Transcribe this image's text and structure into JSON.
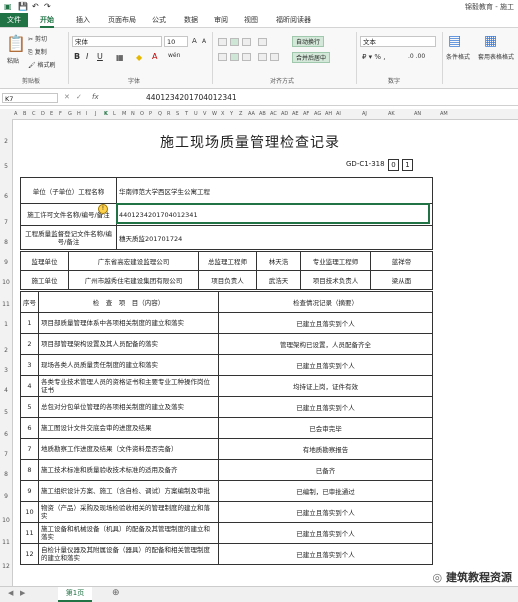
{
  "app": {
    "title": "锦毅教育 - 施工",
    "quick_access": [
      "save-icon",
      "undo-icon",
      "redo-icon"
    ]
  },
  "tabs": [
    "文件",
    "开始",
    "插入",
    "页面布局",
    "公式",
    "数据",
    "审阅",
    "视图",
    "福昕阅读器"
  ],
  "ribbon": {
    "clipboard": {
      "paste": "粘贴",
      "cut": "剪切",
      "copy": "复制",
      "format_painter": "格式刷",
      "group": "剪贴板"
    },
    "font": {
      "name": "宋体",
      "size": "10",
      "group": "字体",
      "bold": "B",
      "italic": "I",
      "underline": "U",
      "grow": "A",
      "shrink": "A",
      "wen": "wén"
    },
    "alignment": {
      "wrap": "自动换行",
      "merge": "合并后居中",
      "group": "对齐方式"
    },
    "number": {
      "format": "文本",
      "group": "数字"
    },
    "styles": {
      "conditional": "条件格式",
      "table": "套用表格格式"
    }
  },
  "formula_bar": {
    "name_box": "K7",
    "value": "440123420170401234​1"
  },
  "columns": "A B C D E F G H I J K L M N O P Q R S T U V W X Y Z AA AB AC AD AE AF AG AH AI AJ AK AN AM",
  "sheet": {
    "title": "施工现场质量管理检查记录",
    "code": "GD-C1-318",
    "code_box1": "0",
    "code_box2": "1",
    "info": [
      {
        "label": "单位（子单位）工程名称",
        "value": "华南师范大学西区学生公寓工程"
      },
      {
        "label": "施工许可文件名称/编号/备注",
        "value": "440123420170401234​1"
      },
      {
        "label": "工程质量监督登记文件名称/编号/备注",
        "value": "穗天质监2017017​24"
      }
    ],
    "parties": [
      [
        "监理单位",
        "广东省高宏建设监理公司",
        "总监理工程师",
        "林天浩",
        "专业监理工程师",
        "蓝祥帝"
      ],
      [
        "施工单位",
        "广州市越秀住宅建设集团有限公司",
        "项目负责人",
        "武浩天",
        "项目技术负责人",
        "梁从面"
      ]
    ],
    "items_header": {
      "no": "序号",
      "content": "检　查　项　目（内容）",
      "result": "检查情况记录（摘要）"
    },
    "items": [
      {
        "no": "1",
        "content": "项目部质量管理体系中各项相关制度的建立和落实",
        "result": "已建立且落实到个人"
      },
      {
        "no": "2",
        "content": "项目部管理架构设置及其人员配备的落实",
        "result": "管理架构已设置，人员配备齐全"
      },
      {
        "no": "3",
        "content": "现场各类人员质量责任制度的建立和落实",
        "result": "已建立且落实到个人"
      },
      {
        "no": "4",
        "content": "各类专业技术管理人员的资格证书和主要专业工种操作岗位证书",
        "result": "均持证上岗，证件有效"
      },
      {
        "no": "5",
        "content": "总包对分包单位管理的各项相关制度的建立及落实",
        "result": "已建立且落实到个人"
      },
      {
        "no": "6",
        "content": "施工图设计文件交底会审的进度及结果",
        "result": "已会审完毕"
      },
      {
        "no": "7",
        "content": "地质勘察工作进度及结果（文件资料是否完备）",
        "result": "有地质勘察报告"
      },
      {
        "no": "8",
        "content": "施工技术标准和质量验收技术标准的适用及备齐",
        "result": "已备齐"
      },
      {
        "no": "9",
        "content": "施工组织设计方案、施工（含自检、调试）方案编制及审批",
        "result": "已编制，已审批通过"
      },
      {
        "no": "10",
        "content": "物资（产品）采购及现场检验收相关的管理制度的建立和落实",
        "result": "已建立且落实到个人"
      },
      {
        "no": "11",
        "content": "施工设备和机械设备（机具）的配备及其管理制度的建立和落实",
        "result": "已建立且落实到个人"
      },
      {
        "no": "12",
        "content": "自检计量仪器及其附属设备（器具）的配备和相关管理制度的建立和落实",
        "result": "已建立且落实到个人"
      }
    ]
  },
  "bottom": {
    "sheet_tab": "第1页",
    "add": "⊕",
    "watermark": "建筑教程资源"
  }
}
